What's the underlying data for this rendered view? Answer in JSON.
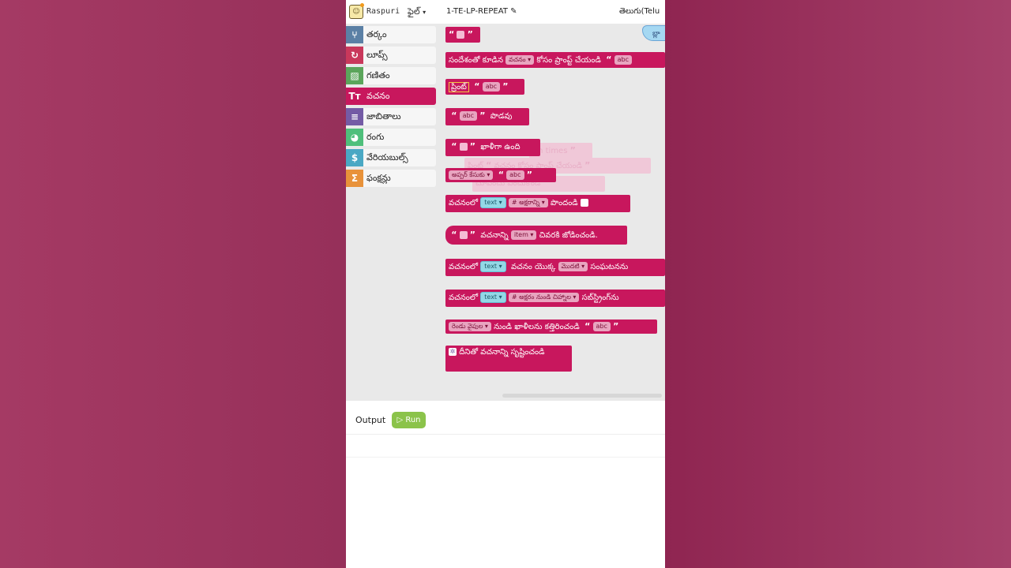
{
  "app": {
    "brand": "Raspuri",
    "file_menu": "ఫైల్",
    "project_name": "1-TE-LP-REPEAT",
    "language": "తెలుగు(Telu",
    "flyout_edge_text": "బ్లా"
  },
  "toolbox": {
    "categories": [
      {
        "label": "తర్కం",
        "color": "#5b80a5",
        "icon": "branch-icon"
      },
      {
        "label": "లూప్స్",
        "color": "#c9385b",
        "icon": "loop-icon"
      },
      {
        "label": "గణితం",
        "color": "#5ba55b",
        "icon": "math-icon"
      },
      {
        "label": "వచనం",
        "color": "#c8175d",
        "icon": "text-icon"
      },
      {
        "label": "జాబితాలు",
        "color": "#745ba5",
        "icon": "list-icon"
      },
      {
        "label": "రంగు",
        "color": "#4fbf7b",
        "icon": "palette-icon"
      },
      {
        "label": "వేరియబుల్స్",
        "color": "#4aa8c4",
        "icon": "dollar-icon"
      },
      {
        "label": "ఫంక్షన్లు",
        "color": "#e8923a",
        "icon": "sigma-icon"
      }
    ]
  },
  "blocks": {
    "get_prompt": {
      "text": "సందేశంతో కూడిన",
      "dropdown": "వచనం",
      "text2": "కోసం ప్రాంప్ట్ చేయండి",
      "value": "abc"
    },
    "print": {
      "text": "ప్రింట్",
      "value": "abc"
    },
    "count_text": {
      "value": "abc",
      "text": "పొడవు"
    },
    "is_empty": {
      "text": "ఖాళీగా ఉంది"
    },
    "to_case": {
      "dropdown": "అప్పర్ కేసుకు",
      "value": "abc"
    },
    "get_char": {
      "text": "వచనంలో",
      "var": "text",
      "dropdown": "# అక్షరాన్ని",
      "text2": "పొందండి"
    },
    "append": {
      "text": "వచనాన్ని",
      "var": "item",
      "text2": "చివరకి జోడించండి."
    },
    "index_of": {
      "text": "వచనంలో",
      "var": "text",
      "text2": "వచనం యొక్క",
      "dropdown": "మొదటి",
      "text3": "సంఘటనను"
    },
    "substring": {
      "text": "వచనంలో",
      "var": "text",
      "dropdown": "# అక్షరం నుండి చిహ్నాల",
      "text2": "సబ్‌స్ట్రింగ్‌ను"
    },
    "trim": {
      "dropdown": "రెండు వైపుల",
      "text": "నుండి ఖాళీలను కత్తిరించండి",
      "value": "abc"
    },
    "join": {
      "text": "దీనితో వచనాన్ని సృష్టించండి"
    },
    "ghost": {
      "repeat": "t n times",
      "print": "ప్రింట్",
      "prompt": "వచనం కోసం ప్రాంప్ట్ చేయండి",
      "show": "చూపించు ఎంచుకోండి"
    }
  },
  "output": {
    "label": "Output",
    "run_label": "Run"
  }
}
